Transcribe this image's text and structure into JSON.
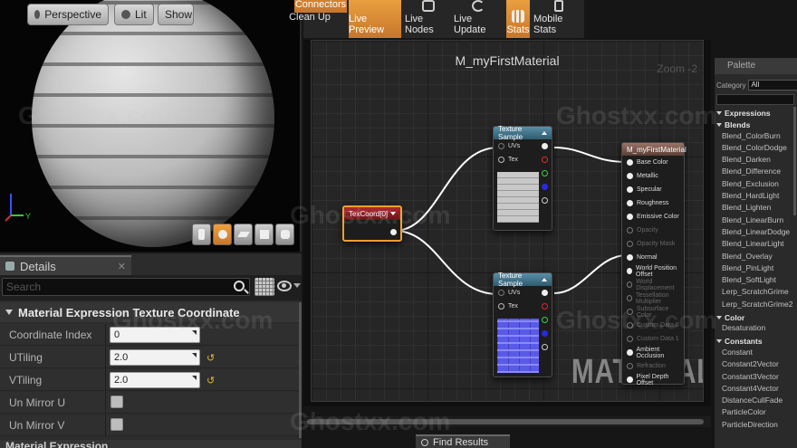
{
  "viewport": {
    "perspective_label": "Perspective",
    "lit_label": "Lit",
    "show_label": "Show",
    "axis_y": "Y"
  },
  "details": {
    "tab_label": "Details",
    "search_placeholder": "Search",
    "section_title": "Material Expression Texture Coordinate",
    "props": [
      {
        "label": "Coordinate Index",
        "value": "0"
      },
      {
        "label": "UTiling",
        "value": "2.0"
      },
      {
        "label": "VTiling",
        "value": "2.0"
      },
      {
        "label": "Un Mirror U"
      },
      {
        "label": "Un Mirror V"
      }
    ],
    "footer_section": "Material Expression"
  },
  "toolbar": {
    "clean_up": "Clean Up",
    "connectors": "Connectors",
    "live_preview": "Live Preview",
    "live_nodes": "Live Nodes",
    "live_update": "Live Update",
    "stats": "Stats",
    "mobile_stats": "Mobile Stats"
  },
  "graph": {
    "title": "M_myFirstMaterial",
    "zoom": "Zoom -2",
    "watermark": "MATERIAL",
    "texcoord_title": "TexCoord[0]",
    "texture_sample_title": "Texture Sample",
    "texture_pins": [
      "UVs",
      "Tex"
    ],
    "result_title": "M_myFirstMaterial",
    "result_pins": [
      {
        "label": "Base Color",
        "enabled": true
      },
      {
        "label": "Metallic",
        "enabled": true
      },
      {
        "label": "Specular",
        "enabled": true
      },
      {
        "label": "Roughness",
        "enabled": true
      },
      {
        "label": "Emissive Color",
        "enabled": true
      },
      {
        "label": "Opacity",
        "enabled": false
      },
      {
        "label": "Opacity Mask",
        "enabled": false
      },
      {
        "label": "Normal",
        "enabled": true
      },
      {
        "label": "World Position Offset",
        "enabled": true
      },
      {
        "label": "World Displacement",
        "enabled": false
      },
      {
        "label": "Tessellation Multiplier",
        "enabled": false
      },
      {
        "label": "Subsurface Color",
        "enabled": false
      },
      {
        "label": "Custom Data 0",
        "enabled": false
      },
      {
        "label": "Custom Data 1",
        "enabled": false
      },
      {
        "label": "Ambient Occlusion",
        "enabled": true
      },
      {
        "label": "Refraction",
        "enabled": false
      },
      {
        "label": "Pixel Depth Offset",
        "enabled": true
      }
    ]
  },
  "palette": {
    "tab_label": "Palette",
    "category_label": "Category",
    "category_value": "All",
    "items": [
      {
        "label": "Expressions",
        "header": true
      },
      {
        "label": "Blends",
        "header": true
      },
      {
        "label": "Blend_ColorBurn"
      },
      {
        "label": "Blend_ColorDodge"
      },
      {
        "label": "Blend_Darken"
      },
      {
        "label": "Blend_Difference"
      },
      {
        "label": "Blend_Exclusion"
      },
      {
        "label": "Blend_HardLight"
      },
      {
        "label": "Blend_Lighten"
      },
      {
        "label": "Blend_LinearBurn"
      },
      {
        "label": "Blend_LinearDodge"
      },
      {
        "label": "Blend_LinearLight"
      },
      {
        "label": "Blend_Overlay"
      },
      {
        "label": "Blend_PinLight"
      },
      {
        "label": "Blend_SoftLight"
      },
      {
        "label": "Lerp_ScratchGrime"
      },
      {
        "label": "Lerp_ScratchGrime2"
      },
      {
        "label": "Color",
        "header": true
      },
      {
        "label": "Desaturation"
      },
      {
        "label": "Constants",
        "header": true
      },
      {
        "label": "Constant"
      },
      {
        "label": "Constant2Vector"
      },
      {
        "label": "Constant3Vector"
      },
      {
        "label": "Constant4Vector"
      },
      {
        "label": "DistanceCullFade"
      },
      {
        "label": "ParticleColor"
      },
      {
        "label": "ParticleDirection"
      }
    ]
  },
  "find_results": "Find Results",
  "watermark_text": "Ghostxx.com",
  "colors": {
    "accent_orange": "#e8a040",
    "teal_header": "#4a7d95",
    "red_header": "#9c2530",
    "pin_red": "#e02a2a",
    "pin_green": "#3ad23a",
    "pin_blue": "#2a2ae0"
  }
}
